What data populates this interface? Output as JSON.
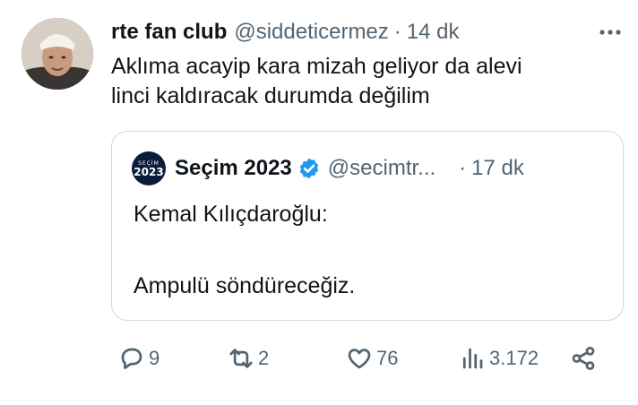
{
  "tweet": {
    "display_name": "rte fan club",
    "handle": "@siddeticermez",
    "separator": "·",
    "time": "14 dk",
    "text": "Aklıma acayip kara mizah geliyor da alevi\nlinci kaldıracak durumda değilim"
  },
  "quote": {
    "avatar_small": "SEÇİM",
    "avatar_big": "2023",
    "display_name": "Seçim 2023",
    "handle": "@secimtr...",
    "separator": "·",
    "time": "17 dk",
    "text": "Kemal Kılıçdaroğlu:\n\nAmpulü söndüreceğiz.",
    "verified_icon": "verified-badge-icon"
  },
  "actions": {
    "reply_count": "9",
    "retweet_count": "2",
    "like_count": "76",
    "views_count": "3.172"
  },
  "colors": {
    "text_primary": "#0f1419",
    "text_secondary": "#536471",
    "border": "#cfd9de",
    "verified": "#1d9bf0"
  }
}
